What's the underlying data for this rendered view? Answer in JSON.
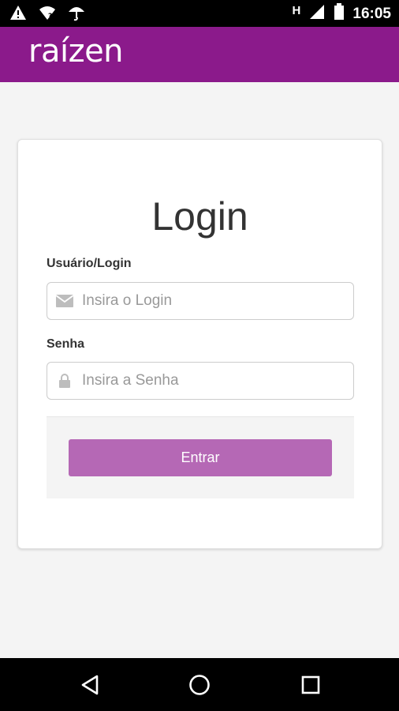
{
  "status_bar": {
    "time": "16:05",
    "network_letter": "H",
    "icons": [
      "warning-icon",
      "wifi-question-icon",
      "umbrella-icon",
      "signal-icon",
      "battery-icon"
    ]
  },
  "header": {
    "brand": "raízen",
    "color": "#8b1a8b"
  },
  "login": {
    "title": "Login",
    "username": {
      "label": "Usuário/Login",
      "placeholder": "Insira o Login",
      "value": "",
      "icon": "envelope-icon"
    },
    "password": {
      "label": "Senha",
      "placeholder": "Insira a Senha",
      "value": "",
      "icon": "lock-icon"
    },
    "submit_label": "Entrar",
    "button_color": "#b568b5"
  },
  "nav_bar": {
    "icons": [
      "back-icon",
      "home-icon",
      "recents-icon"
    ]
  }
}
